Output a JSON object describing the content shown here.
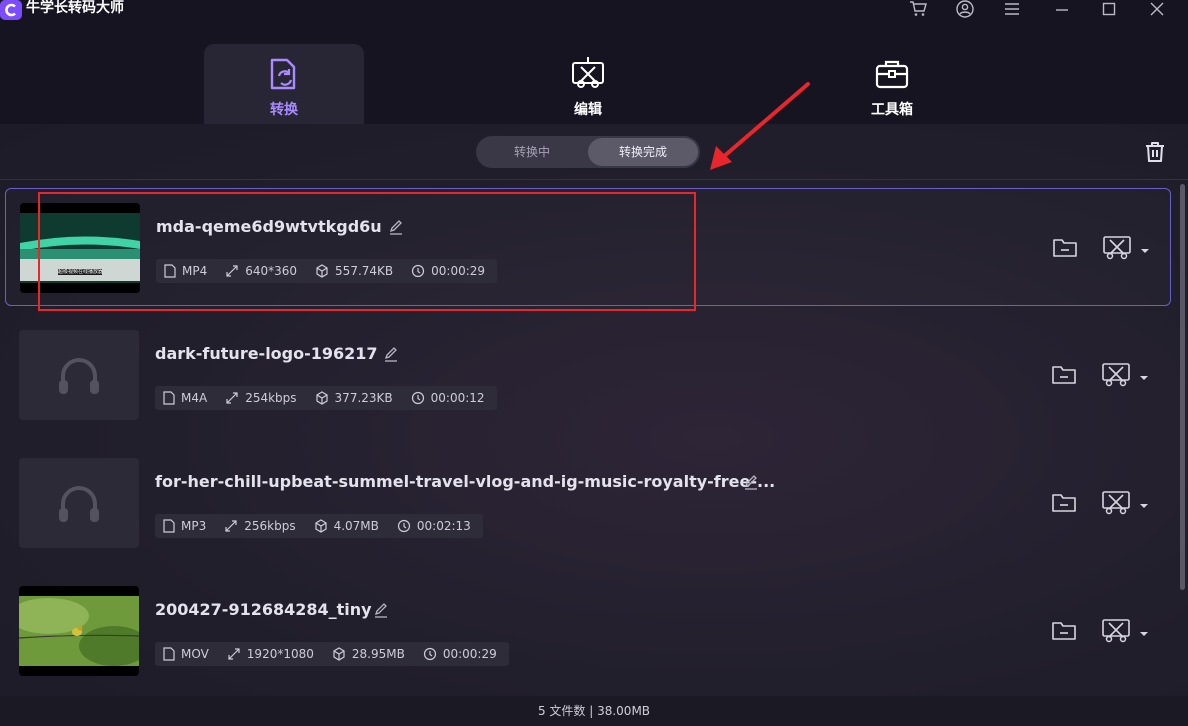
{
  "app": {
    "title": "牛学长转码大师"
  },
  "nav": {
    "tabs": [
      {
        "label": "转换"
      },
      {
        "label": "编辑"
      },
      {
        "label": "工具箱"
      }
    ]
  },
  "filter": {
    "tab_converting": "转换中",
    "tab_done": "转换完成"
  },
  "files": [
    {
      "name": "mda-qeme6d9wtvtkgd6u",
      "format": "MP4",
      "resolution": "640*360",
      "size": "557.74KB",
      "duration": "00:00:29",
      "thumb_caption": "超级视频在线播放器"
    },
    {
      "name": "dark-future-logo-196217",
      "format": "M4A",
      "resolution": "254kbps",
      "size": "377.23KB",
      "duration": "00:00:12"
    },
    {
      "name": "for-her-chill-upbeat-summel-travel-vlog-and-ig-music-royalty-free-...",
      "format": "MP3",
      "resolution": "256kbps",
      "size": "4.07MB",
      "duration": "00:02:13"
    },
    {
      "name": "200427-912684284_tiny",
      "format": "MOV",
      "resolution": "1920*1080",
      "size": "28.95MB",
      "duration": "00:00:29"
    }
  ],
  "footer": {
    "summary": "5 文件数 | 38.00MB"
  },
  "colors": {
    "accent": "#7b4dff",
    "annotation": "#e8262b",
    "selection_border": "#6a5fc6"
  }
}
